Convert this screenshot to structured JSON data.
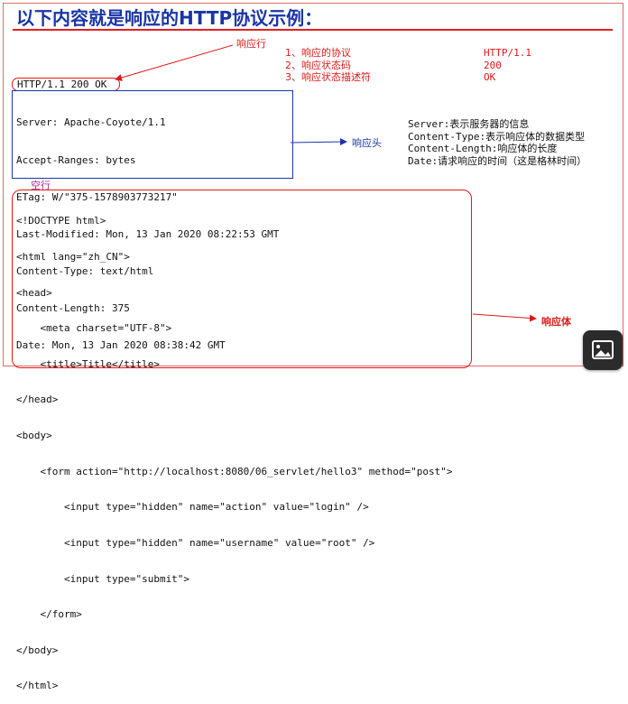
{
  "title": "以下内容就是响应的HTTP协议示例：",
  "annotations": {
    "status_line_label": "响应行",
    "headers_label": "响应头",
    "blank_line_label": "空行",
    "body_label": "响应体"
  },
  "status_parts": [
    {
      "label": "1、响应的协议",
      "value": "HTTP/1.1"
    },
    {
      "label": "2、响应状态码",
      "value": "200"
    },
    {
      "label": "3、响应状态描述符",
      "value": "OK"
    }
  ],
  "status_line": "HTTP/1.1 200 OK",
  "headers": [
    "Server: Apache-Coyote/1.1",
    "Accept-Ranges: bytes",
    "ETag: W/\"375-1578903773217\"",
    "Last-Modified: Mon, 13 Jan 2020 08:22:53 GMT",
    "Content-Type: text/html",
    "Content-Length: 375",
    "Date: Mon, 13 Jan 2020 08:38:42 GMT"
  ],
  "header_notes": [
    "Server:表示服务器的信息",
    "Content-Type:表示响应体的数据类型",
    "Content-Length:响应体的长度",
    "Date:请求响应的时间（这是格林时间）"
  ],
  "body_lines": [
    "<!DOCTYPE html>",
    "<html lang=\"zh_CN\">",
    "<head>",
    "    <meta charset=\"UTF-8\">",
    "    <title>Title</title>",
    "</head>",
    "<body>",
    "    <form action=\"http://localhost:8080/06_servlet/hello3\" method=\"post\">",
    "        <input type=\"hidden\" name=\"action\" value=\"login\" />",
    "        <input type=\"hidden\" name=\"username\" value=\"root\" />",
    "        <input type=\"submit\">",
    "    </form>",
    "</body>",
    "</html>"
  ],
  "icons": {
    "image_button": "image-icon"
  },
  "colors": {
    "title": "#1a35a6",
    "annotation_red": "#e01818",
    "annotation_blue": "#1a35a6"
  }
}
